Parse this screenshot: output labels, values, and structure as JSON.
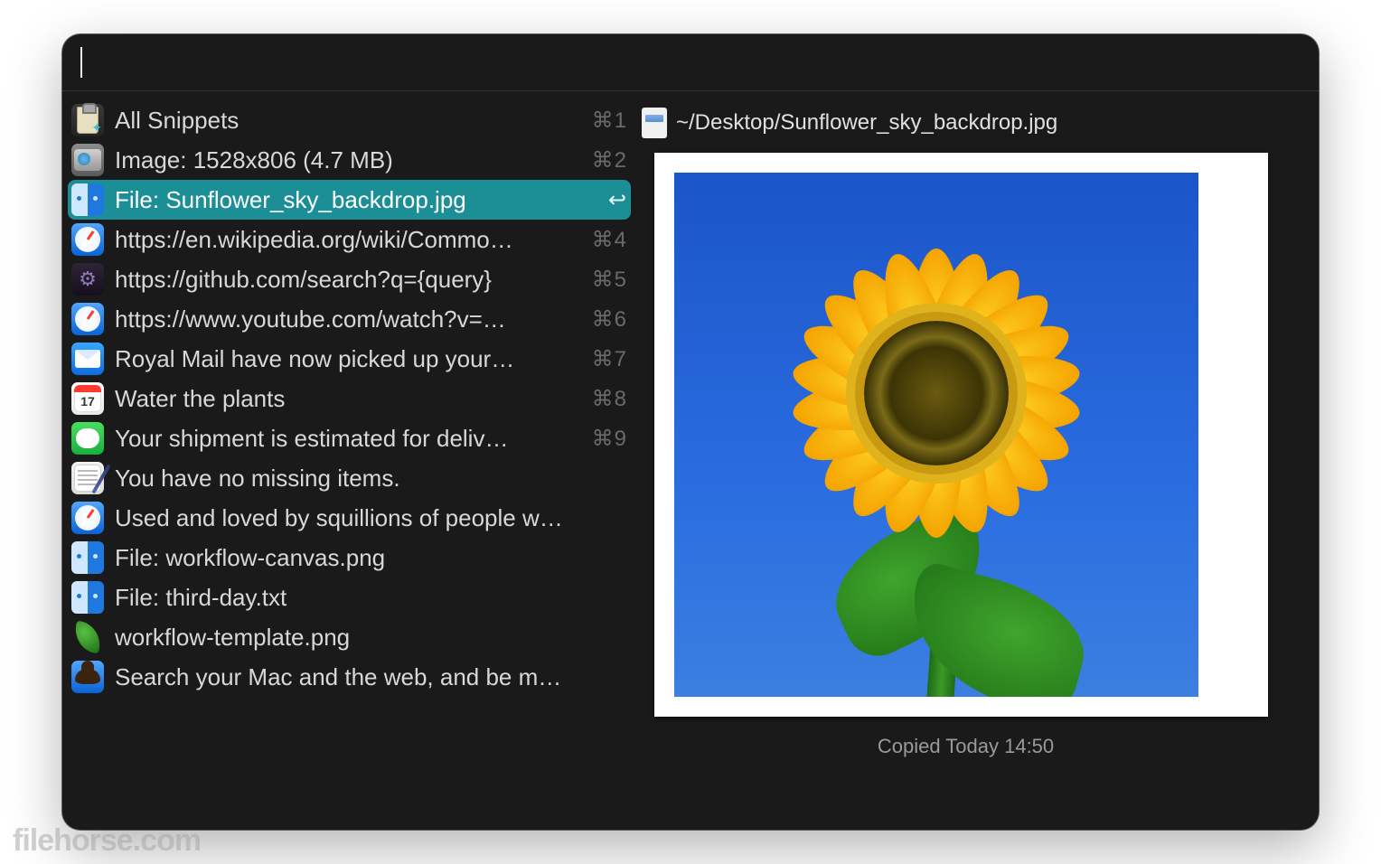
{
  "search": {
    "value": ""
  },
  "items": [
    {
      "icon": "clipboard",
      "label": "All Snippets",
      "shortcut": "⌘1",
      "selected": false
    },
    {
      "icon": "preview",
      "label": "Image: 1528x806 (4.7 MB)",
      "shortcut": "⌘2",
      "selected": false
    },
    {
      "icon": "finder",
      "label": "File: Sunflower_sky_backdrop.jpg",
      "shortcut": "↩",
      "selected": true
    },
    {
      "icon": "safari",
      "label": "https://en.wikipedia.org/wiki/Commo…",
      "shortcut": "⌘4",
      "selected": false
    },
    {
      "icon": "gear",
      "label": "https://github.com/search?q={query}",
      "shortcut": "⌘5",
      "selected": false
    },
    {
      "icon": "safari",
      "label": "https://www.youtube.com/watch?v=…",
      "shortcut": "⌘6",
      "selected": false
    },
    {
      "icon": "mail",
      "label": "Royal Mail have now picked up your…",
      "shortcut": "⌘7",
      "selected": false
    },
    {
      "icon": "calendar",
      "label": "Water the plants",
      "shortcut": "⌘8",
      "selected": false
    },
    {
      "icon": "messages",
      "label": "Your shipment is estimated for deliv…",
      "shortcut": "⌘9",
      "selected": false
    },
    {
      "icon": "notes",
      "label": "You have no missing items.",
      "shortcut": "",
      "selected": false
    },
    {
      "icon": "safari",
      "label": "Used and loved by squillions of people w…",
      "shortcut": "",
      "selected": false
    },
    {
      "icon": "finder",
      "label": "File: workflow-canvas.png",
      "shortcut": "",
      "selected": false
    },
    {
      "icon": "finder",
      "label": "File: third-day.txt",
      "shortcut": "",
      "selected": false
    },
    {
      "icon": "leaf",
      "label": "workflow-template.png",
      "shortcut": "",
      "selected": false
    },
    {
      "icon": "alfred",
      "label": "Search your Mac and the web, and be m…",
      "shortcut": "",
      "selected": false
    }
  ],
  "preview": {
    "path": "~/Desktop/Sunflower_sky_backdrop.jpg",
    "copied_label": "Copied Today 14:50"
  },
  "watermark": "filehorse.com"
}
